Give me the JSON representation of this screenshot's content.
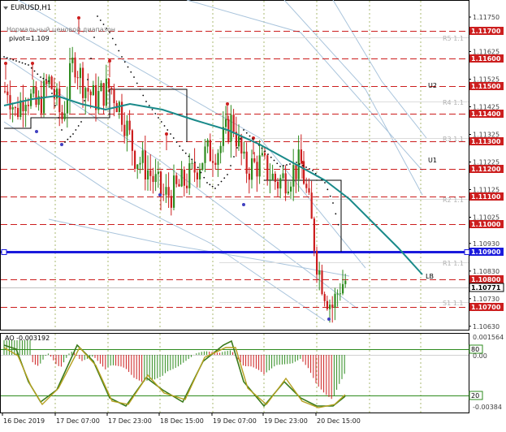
{
  "window": {
    "symbol_title": "EURUSD,H1",
    "indicator_title": "Нормальный ценовой диапазон",
    "pivot_label": "pivot=1.109",
    "ao_label": "AO -0.003192"
  },
  "price_axis": {
    "ticks": [
      "1.11750",
      "1.11625",
      "1.11525",
      "1.11425",
      "1.11325",
      "1.11225",
      "1.11125",
      "1.11025",
      "1.10930",
      "1.10830",
      "1.10730",
      "1.10630"
    ],
    "levels": [
      {
        "label": "1.11700",
        "role": "resistance"
      },
      {
        "label": "1.11600",
        "role": "resistance"
      },
      {
        "label": "1.11500",
        "role": "resistance"
      },
      {
        "label": "1.11400",
        "role": "resistance"
      },
      {
        "label": "1.11300",
        "role": "resistance"
      },
      {
        "label": "1.11200",
        "role": "resistance"
      },
      {
        "label": "1.11100",
        "role": "resistance"
      },
      {
        "label": "1.11000",
        "role": "resistance"
      },
      {
        "label": "1.10900",
        "role": "pivot"
      },
      {
        "label": "1.10800",
        "role": "resistance"
      },
      {
        "label": "1.10771",
        "role": "current"
      },
      {
        "label": "1.10700",
        "role": "resistance"
      }
    ]
  },
  "level_tags": {
    "r5": "R5 1.1",
    "r4": "R4 1.1",
    "r3": "R3 1.1",
    "r2": "R2 1.1",
    "r1": "R1 1.1",
    "s1": "S1 1.1",
    "u2": "U2",
    "u1": "U1",
    "lb": "LB"
  },
  "ao_axis": {
    "ticks": [
      "0.001564",
      "0.00",
      "-0.00384"
    ],
    "levels": [
      "80",
      "20"
    ]
  },
  "time_axis": {
    "labels": [
      "16 Dec 2019",
      "17 Dec 07:00",
      "17 Dec 23:00",
      "18 Dec 15:00",
      "19 Dec 07:00",
      "19 Dec 23:00",
      "20 Dec 15:00"
    ]
  },
  "colors": {
    "bull": "#2e8b1e",
    "bear": "#cc1e1e",
    "ma": "#1a8a8a",
    "pivot": "#1a1adc",
    "level": "#cc1e1e",
    "label_bg": "#cc1e1e",
    "pivot_bg": "#1a1adc",
    "current_bg": "#ffffff"
  },
  "icons": {
    "buy_arrow": "up-arrow-icon",
    "sell_arrow": "down-arrow-icon",
    "window_menu": "triangle-down-icon"
  }
}
